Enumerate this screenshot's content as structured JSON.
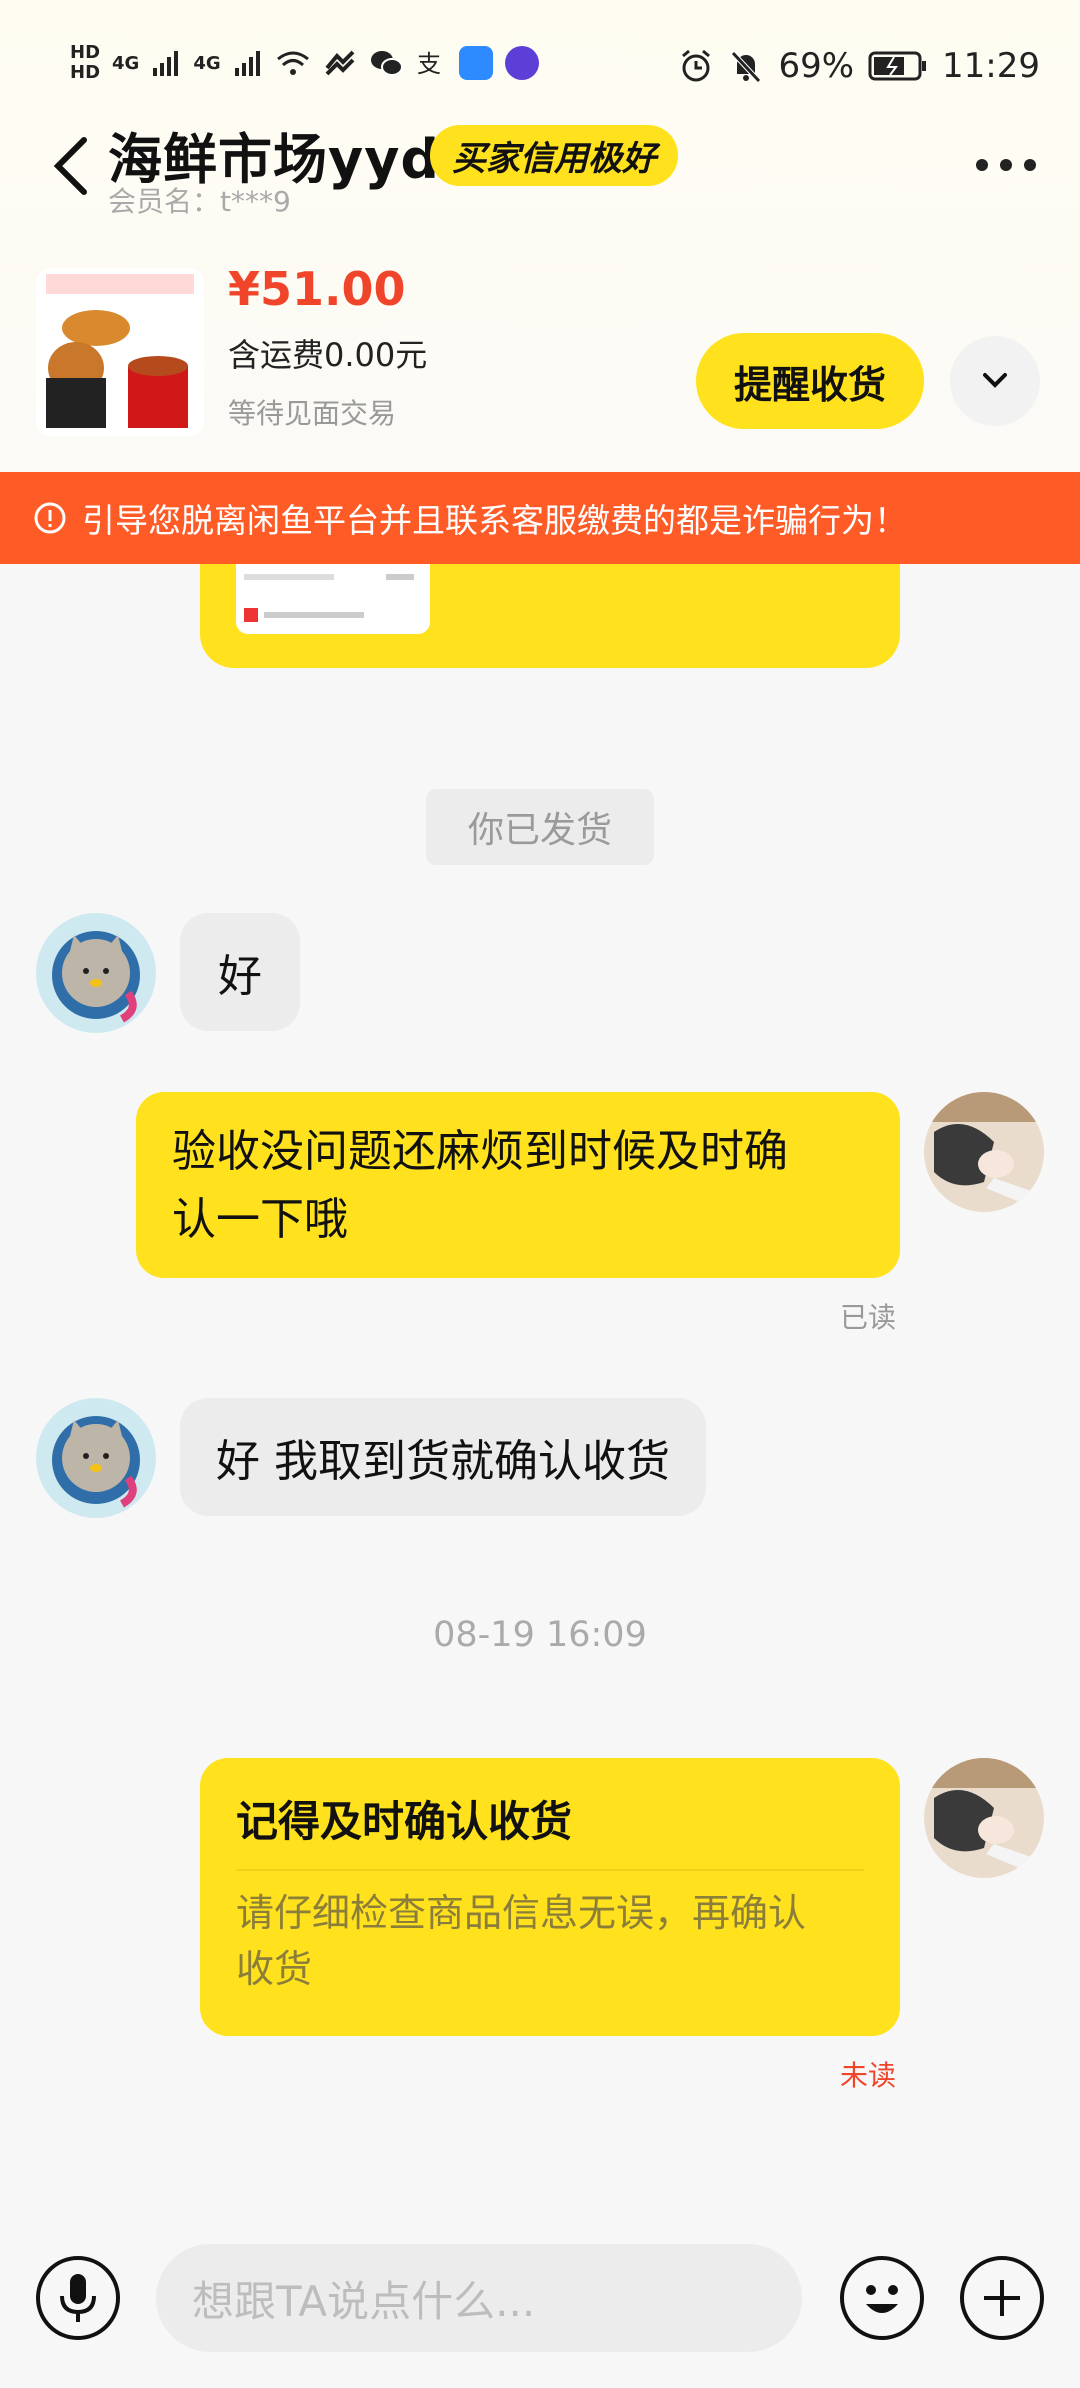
{
  "status_bar": {
    "hd1": "HD",
    "hd2": "HD",
    "net1": "4G",
    "net2": "4G",
    "battery": "69%",
    "time": "11:29"
  },
  "header": {
    "title": "海鲜市场yyds",
    "badge": "买家信用极好",
    "member": "会员名：t***9"
  },
  "product": {
    "price": "¥51.00",
    "freight": "含运费0.00元",
    "status": "等待见面交易",
    "remind_button": "提醒收货"
  },
  "warning": "引导您脱离闲鱼平台并且联系客服缴费的都是诈骗行为！",
  "messages": {
    "system_shipped": "你已发货",
    "m1": "好",
    "m2_line1": "验收没问题还麻烦到时候及时确",
    "m2_line2": "认一下哦",
    "m2_status": "已读",
    "m3": "好 我取到货就确认收货",
    "timestamp": "08-19 16:09",
    "card_title": "记得及时确认收货",
    "card_sub_line1": "请仔细检查商品信息无误，再确认",
    "card_sub_line2": "收货",
    "card_status": "未读"
  },
  "input": {
    "placeholder": "想跟TA说点什么..."
  },
  "colors": {
    "accent_yellow": "#ffe21d",
    "warning_orange": "#ff5b26",
    "price_red": "#f0452a"
  }
}
